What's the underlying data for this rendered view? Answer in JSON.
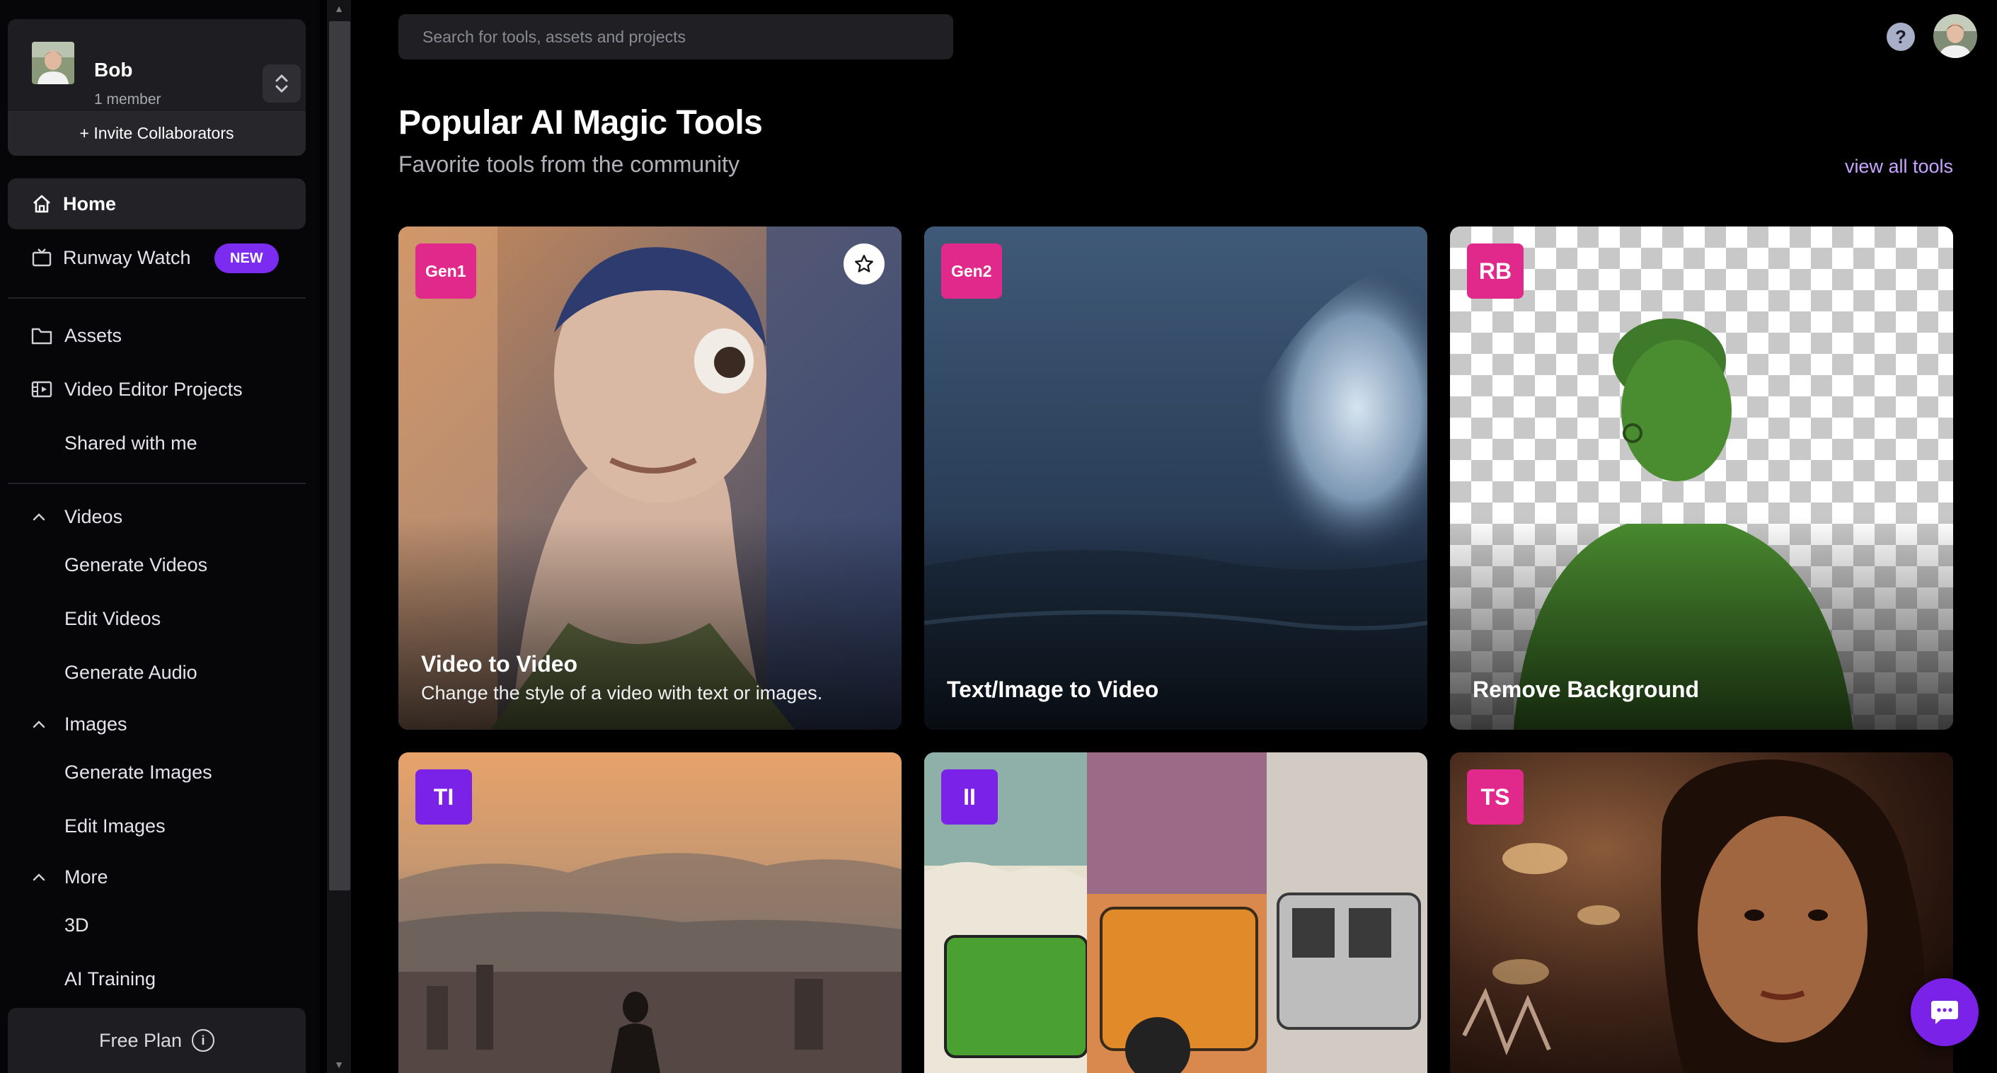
{
  "workspace": {
    "name": "Bob",
    "members": "1 member",
    "invite_label": "+ Invite Collaborators"
  },
  "sidebar": {
    "home": "Home",
    "watch": "Runway Watch",
    "watch_badge": "NEW",
    "assets": "Assets",
    "video_editor": "Video Editor Projects",
    "shared": "Shared with me",
    "videos": {
      "label": "Videos",
      "items": [
        "Generate Videos",
        "Edit Videos",
        "Generate Audio"
      ]
    },
    "images": {
      "label": "Images",
      "items": [
        "Generate Images",
        "Edit Images"
      ]
    },
    "more": {
      "label": "More",
      "items": [
        "3D",
        "AI Training"
      ]
    },
    "plan_label": "Free Plan"
  },
  "header": {
    "search_placeholder": "Search for tools, assets and projects",
    "help": "?"
  },
  "main": {
    "title": "Popular AI Magic Tools",
    "subtitle": "Favorite tools from the community",
    "view_all": "view all tools",
    "cards": [
      {
        "tag": "Gen1",
        "title": "Video to Video",
        "desc": "Change the style of a video with text or images."
      },
      {
        "tag": "Gen2",
        "title": "Text/Image to Video"
      },
      {
        "tag": "RB",
        "title": "Remove Background"
      },
      {
        "tag": "TI"
      },
      {
        "tag": "II"
      },
      {
        "tag": "TS"
      }
    ]
  },
  "colors": {
    "accent_purple": "#7a22e8",
    "tag_pink": "#e1298c",
    "link": "#c7a5ff"
  },
  "icons": [
    "home-icon",
    "tv-icon",
    "folder-icon",
    "film-icon",
    "chevron-up-icon",
    "info-icon",
    "star-icon",
    "help-icon",
    "chat-icon",
    "switch-icon"
  ]
}
